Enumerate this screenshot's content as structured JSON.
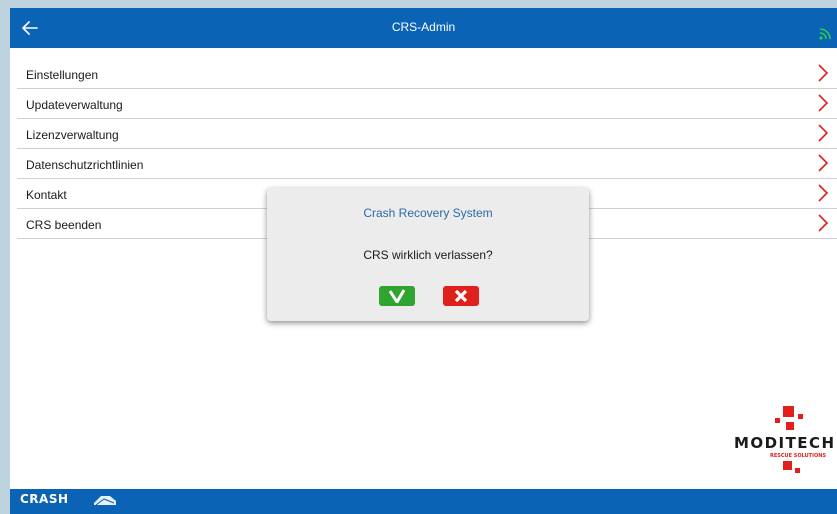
{
  "header": {
    "title": "CRS-Admin",
    "back_icon": "arrow-left-icon",
    "signal_icon": "signal-icon",
    "accent_color": "#0a63b5",
    "signal_color": "#2ecc40"
  },
  "menu": {
    "items": [
      {
        "label": "Einstellungen"
      },
      {
        "label": "Updateverwaltung"
      },
      {
        "label": "Lizenzverwaltung"
      },
      {
        "label": "Datenschutzrichtlinien"
      },
      {
        "label": "Kontakt"
      },
      {
        "label": "CRS beenden"
      }
    ],
    "chevron_color": "#e0211b"
  },
  "dialog": {
    "title": "Crash Recovery System",
    "message": "CRS wirklich verlassen?",
    "confirm_icon": "check-icon",
    "cancel_icon": "x-icon"
  },
  "logo": {
    "name": "moditech",
    "wordmark": "MODITECH",
    "tagline": "RESCUE SOLUTIONS"
  },
  "footer": {
    "brand": "CRASH"
  }
}
